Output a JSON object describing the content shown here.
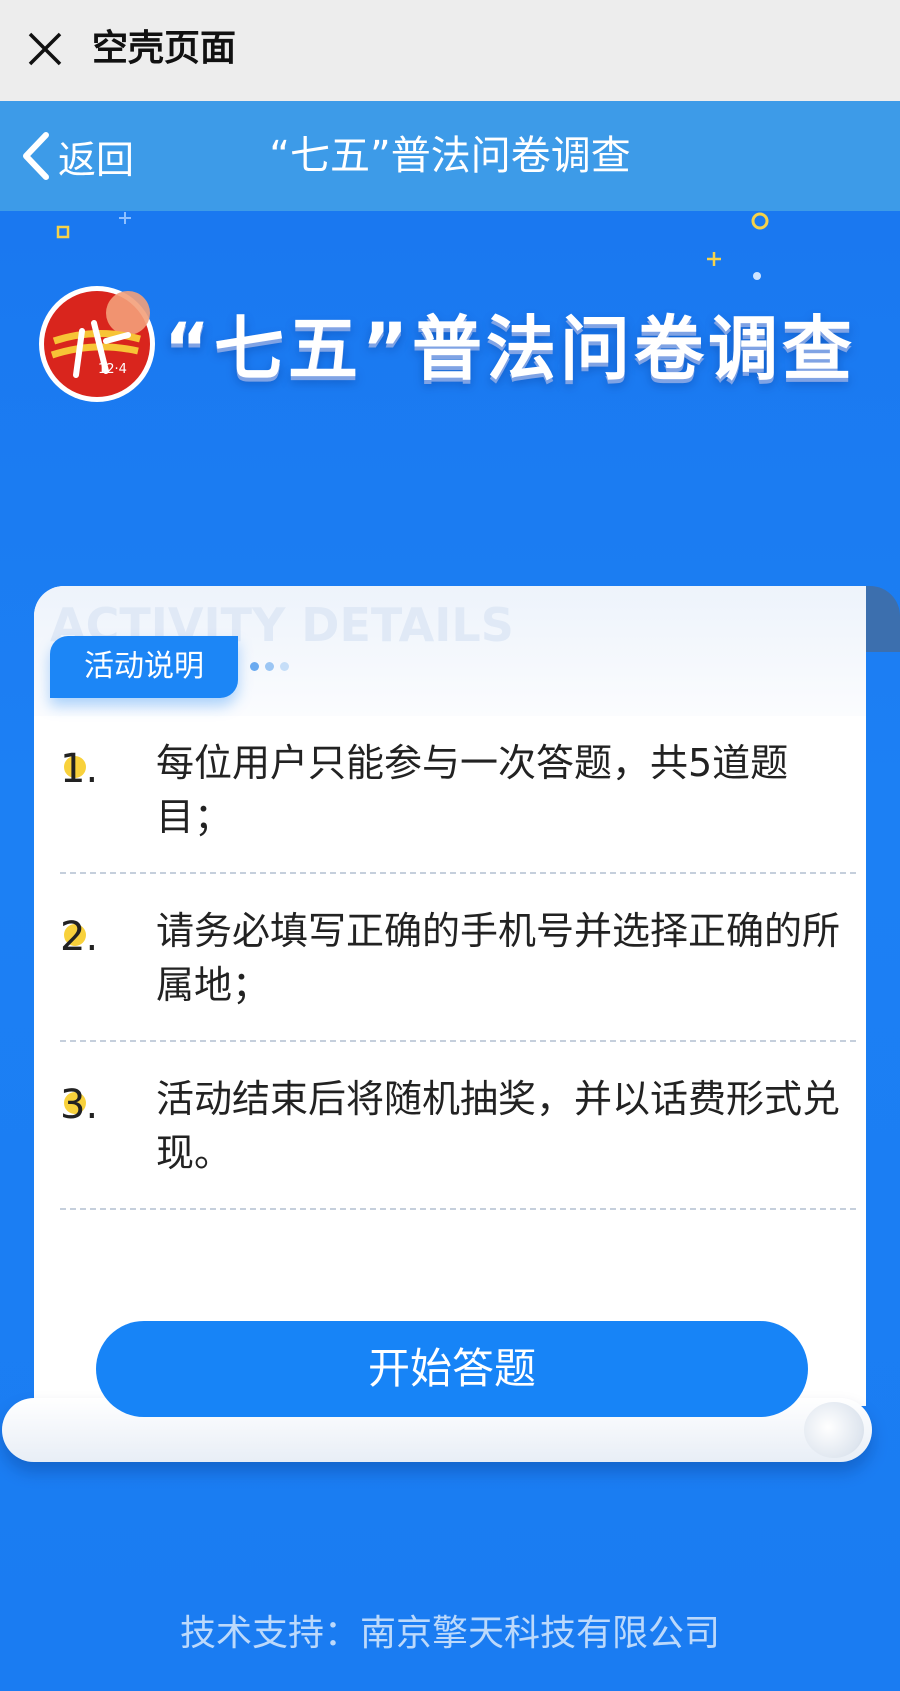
{
  "wechat_bar": {
    "close_icon": "close-icon",
    "title": "空壳页面"
  },
  "app_bar": {
    "back_icon": "chevron-left-icon",
    "back_label": "返回",
    "title": "“七五”普法问卷调查"
  },
  "banner": {
    "logo_icon": "law-12-4-logo",
    "logo_text": "12·4",
    "title": "“七五”普法问卷调查"
  },
  "card": {
    "watermark": "ACTIVITY DETAILS",
    "tag_label": "活动说明",
    "rules": [
      {
        "num": "1.",
        "text": "每位用户只能参与一次答题，共5道题目；"
      },
      {
        "num": "2.",
        "text": "请务必填写正确的手机号并选择正确的所属地；"
      },
      {
        "num": "3.",
        "text": "活动结束后将随机抽奖，并以话费形式兑现。"
      }
    ],
    "start_button": "开始答题"
  },
  "footer": {
    "text": "技术支持：南京擎天科技有限公司"
  },
  "colors": {
    "page_blue": "#1a7bf2",
    "app_bar": "#3d9be8",
    "button": "#1784f7",
    "bullet_yellow": "#f8cf30"
  }
}
